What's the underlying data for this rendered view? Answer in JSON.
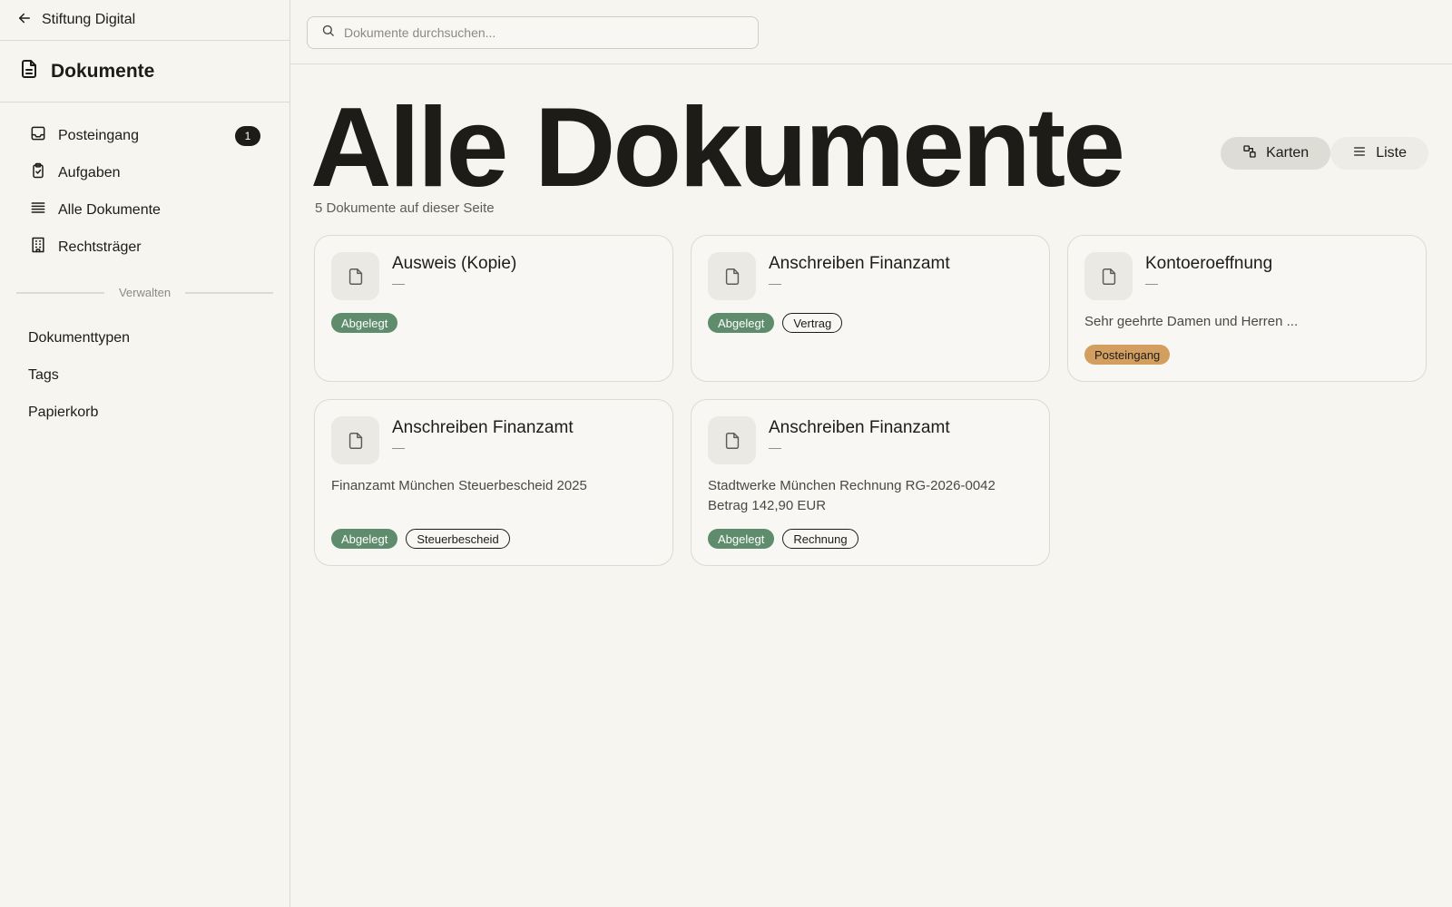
{
  "sidebar": {
    "org_name": "Stiftung Digital",
    "app_title": "Dokumente",
    "nav": [
      {
        "label": "Posteingang",
        "icon": "inbox-icon",
        "badge": "1"
      },
      {
        "label": "Aufgaben",
        "icon": "clipboard-icon"
      },
      {
        "label": "Alle Dokumente",
        "icon": "list-icon"
      },
      {
        "label": "Rechtsträger",
        "icon": "building-icon"
      }
    ],
    "section_label": "Verwalten",
    "manage": [
      {
        "label": "Dokumenttypen"
      },
      {
        "label": "Tags"
      },
      {
        "label": "Papierkorb"
      }
    ]
  },
  "search": {
    "placeholder": "Dokumente durchsuchen..."
  },
  "main": {
    "title": "Alle Dokumente",
    "subtitle": "5 Dokumente auf dieser Seite",
    "view_toggle": {
      "cards_label": "Karten",
      "list_label": "Liste",
      "active": "cards"
    }
  },
  "documents": [
    {
      "title": "Ausweis (Kopie)",
      "subtitle": "—",
      "description": "",
      "tags": [
        {
          "label": "Abgelegt",
          "style": "green"
        }
      ]
    },
    {
      "title": "Anschreiben Finanzamt",
      "subtitle": "—",
      "description": "",
      "tags": [
        {
          "label": "Abgelegt",
          "style": "green"
        },
        {
          "label": "Vertrag",
          "style": "outline"
        }
      ]
    },
    {
      "title": "Kontoeroeffnung",
      "subtitle": "—",
      "description": "Sehr geehrte Damen und Herren ...",
      "tags": [
        {
          "label": "Posteingang",
          "style": "amber"
        }
      ]
    },
    {
      "title": "Anschreiben Finanzamt",
      "subtitle": "—",
      "description": "Finanzamt München Steuerbescheid 2025",
      "tags": [
        {
          "label": "Abgelegt",
          "style": "green"
        },
        {
          "label": "Steuerbescheid",
          "style": "outline"
        }
      ]
    },
    {
      "title": "Anschreiben Finanzamt",
      "subtitle": "—",
      "description": "Stadtwerke München Rechnung RG-2026-0042 Betrag 142,90 EUR",
      "tags": [
        {
          "label": "Abgelegt",
          "style": "green"
        },
        {
          "label": "Rechnung",
          "style": "outline"
        }
      ]
    }
  ],
  "colors": {
    "background": "#f6f5f0",
    "tag_green": "#5e8c6c",
    "tag_amber": "#d39f60",
    "text": "#1d1c18"
  }
}
